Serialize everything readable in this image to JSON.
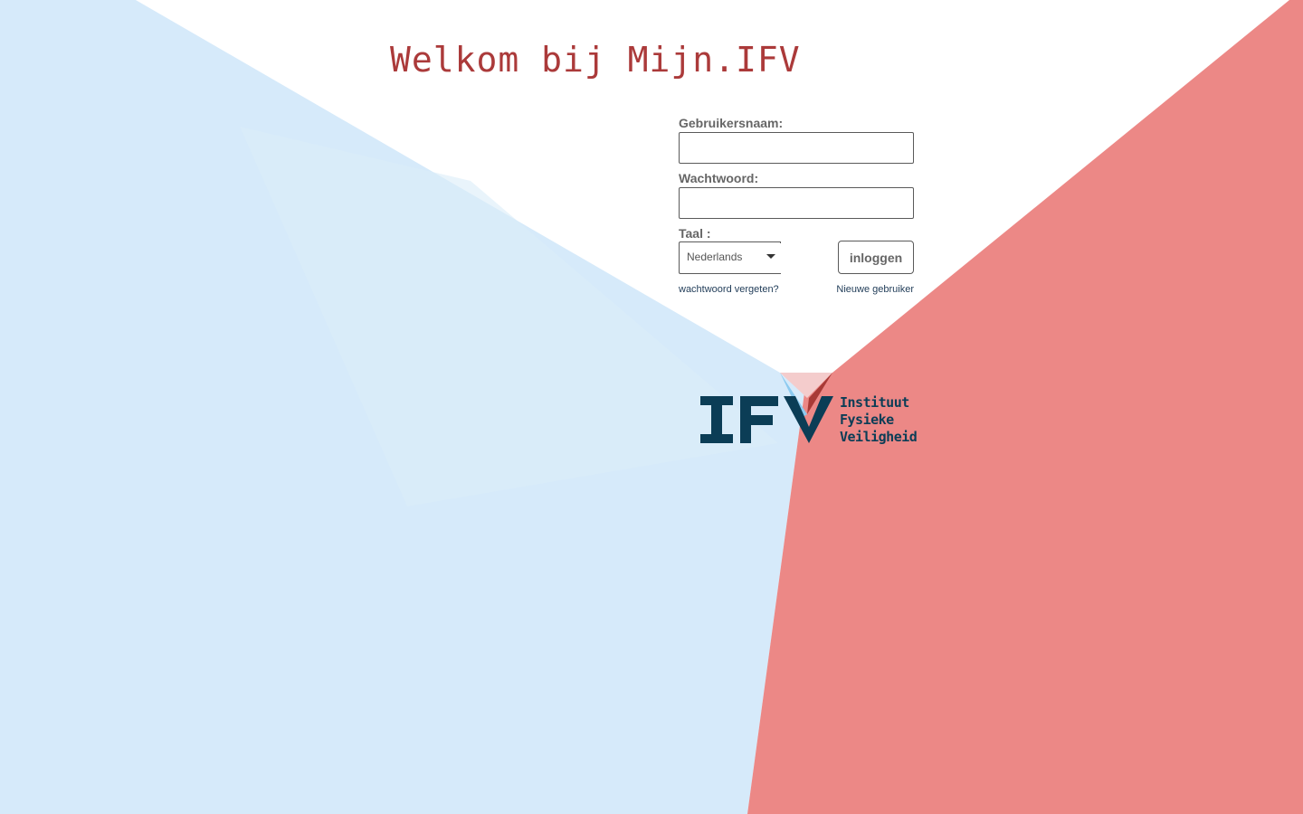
{
  "page": {
    "title": "Welkom bij Mijn.IFV"
  },
  "form": {
    "username_label": "Gebruikersnaam:",
    "username_value": "",
    "password_label": "Wachtwoord:",
    "password_value": "",
    "language_label": "Taal :",
    "language_selected": "Nederlands",
    "login_button": "inloggen",
    "forgot_password_link": "wachtwoord vergeten?",
    "new_user_link": "Nieuwe gebruiker"
  },
  "logo": {
    "line1": "Instituut",
    "line2": "Fysieke",
    "line3": "Veiligheid"
  },
  "colors": {
    "title": "#ab3a3a",
    "background_blue": "#d6eafa",
    "background_red": "#ec8886",
    "brand_dark": "#0b3d56",
    "brand_red": "#a83a36",
    "brand_blue": "#8ccaf0",
    "link": "#1f3b57"
  },
  "icons": {
    "language_dropdown": "chevron-down-icon"
  }
}
